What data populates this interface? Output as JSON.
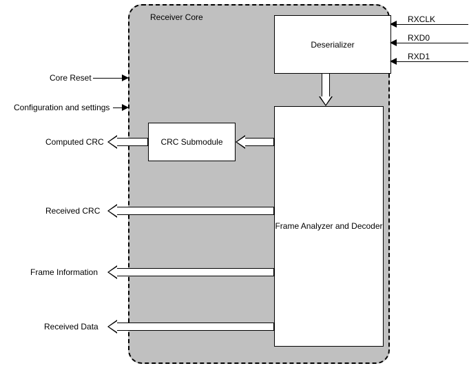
{
  "core": {
    "title": "Receiver Core"
  },
  "blocks": {
    "deserializer": "Deserializer",
    "crc": "CRC Submodule",
    "frame_decoder": "Frame Analyzer and Decoder"
  },
  "inputs_right": {
    "rxclk": "RXCLK",
    "rxd0": "RXD0",
    "rxd1": "RXD1"
  },
  "inputs_left": {
    "core_reset": "Core Reset",
    "config": "Configuration and settings"
  },
  "outputs_left": {
    "computed_crc": "Computed CRC",
    "received_crc": "Received CRC",
    "frame_info": "Frame Information",
    "received_data": "Received Data"
  }
}
